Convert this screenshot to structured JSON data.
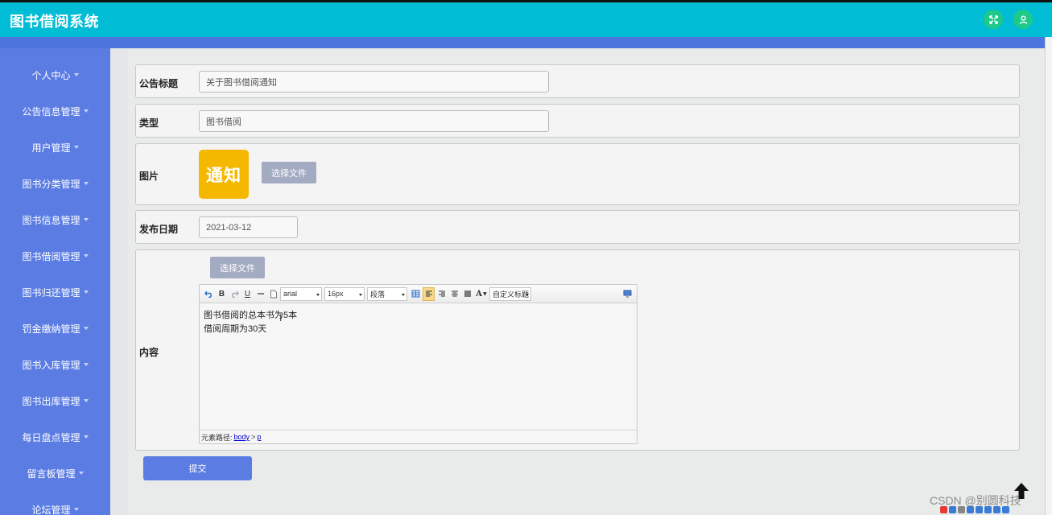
{
  "header": {
    "title": "图书借阅系统",
    "fullscreen_icon": "fullscreen-icon",
    "user_icon": "user-icon",
    "accent": "#00bcd4",
    "button_color": "#1fc98a"
  },
  "sidebar": {
    "color": "#5b7de3",
    "items": [
      {
        "label": "个人中心"
      },
      {
        "label": "公告信息管理"
      },
      {
        "label": "用户管理"
      },
      {
        "label": "图书分类管理"
      },
      {
        "label": "图书信息管理"
      },
      {
        "label": "图书借阅管理"
      },
      {
        "label": "图书归还管理"
      },
      {
        "label": "罚金缴纳管理"
      },
      {
        "label": "图书入库管理"
      },
      {
        "label": "图书出库管理"
      },
      {
        "label": "每日盘点管理"
      },
      {
        "label": "留言板管理"
      },
      {
        "label": "论坛管理"
      }
    ]
  },
  "form": {
    "title_label": "公告标题",
    "title_value": "关于图书借阅通知",
    "type_label": "类型",
    "type_value": "图书借阅",
    "image_label": "图片",
    "image_thumb_text": "通知",
    "image_file_button": "选择文件",
    "date_label": "发布日期",
    "date_value": "2021-03-12",
    "content_label": "内容",
    "content_file_button": "选择文件",
    "submit_label": "提交"
  },
  "editor": {
    "font_family": "arial",
    "font_size": "16px",
    "paragraph": "段落",
    "custom_title": "自定义标题",
    "bold": "B",
    "underline": "U",
    "font_color": "A",
    "lines": [
      "图书借阅的总本书为5本",
      "借阅周期为30天"
    ],
    "path_label": "元素路径:",
    "path_items": [
      "body",
      "p"
    ],
    "path_sep": ">"
  },
  "overlay": {
    "watermark": "CSDN @别圆科技"
  }
}
